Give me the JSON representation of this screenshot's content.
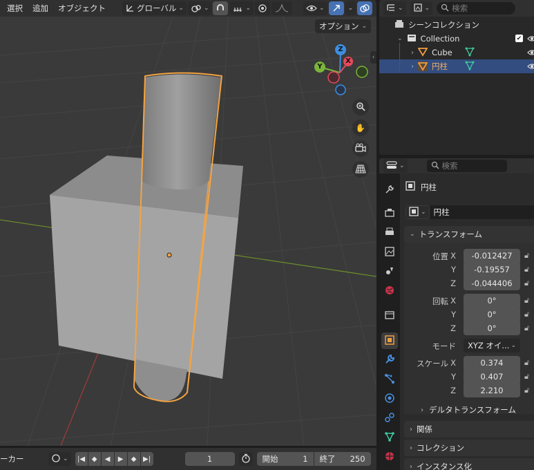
{
  "viewport": {
    "menus": [
      "選択",
      "追加",
      "オブジェクト"
    ],
    "orientation": "グローバル",
    "options_label": "オプション",
    "gizmo": {
      "z": "Z",
      "y": "Y",
      "x": "X"
    }
  },
  "timeline": {
    "marker_label": "ーカー",
    "current_frame": "1",
    "start_label": "開始",
    "start_value": "1",
    "end_label": "終了",
    "end_value": "250"
  },
  "outliner": {
    "search_placeholder": "検索",
    "scene_collection": "シーンコレクション",
    "collection": "Collection",
    "items": [
      {
        "name": "Cube",
        "selected": false
      },
      {
        "name": "円柱",
        "selected": true
      }
    ]
  },
  "properties": {
    "search_placeholder": "検索",
    "object_name": "円柱",
    "object_name_field": "円柱",
    "transform": {
      "title": "トランスフォーム",
      "location_label": "位置",
      "rotation_label": "回転",
      "scale_label": "スケール",
      "axis_x": "X",
      "axis_y": "Y",
      "axis_z": "Z",
      "location": [
        "-0.012427",
        "-0.19557",
        "-0.044406"
      ],
      "rotation": [
        "0°",
        "0°",
        "0°"
      ],
      "mode_label": "モード",
      "mode_value": "XYZ オイ...",
      "scale": [
        "0.374",
        "0.407",
        "2.210"
      ],
      "delta": "デルタトランスフォーム"
    },
    "panels": [
      "関係",
      "コレクション",
      "インスタンス化"
    ]
  },
  "colors": {
    "accent": "#4772b3",
    "selection": "#f5a442",
    "axis_x": "#e8485c",
    "axis_y": "#7ab43a",
    "axis_z": "#3d8ee0"
  }
}
